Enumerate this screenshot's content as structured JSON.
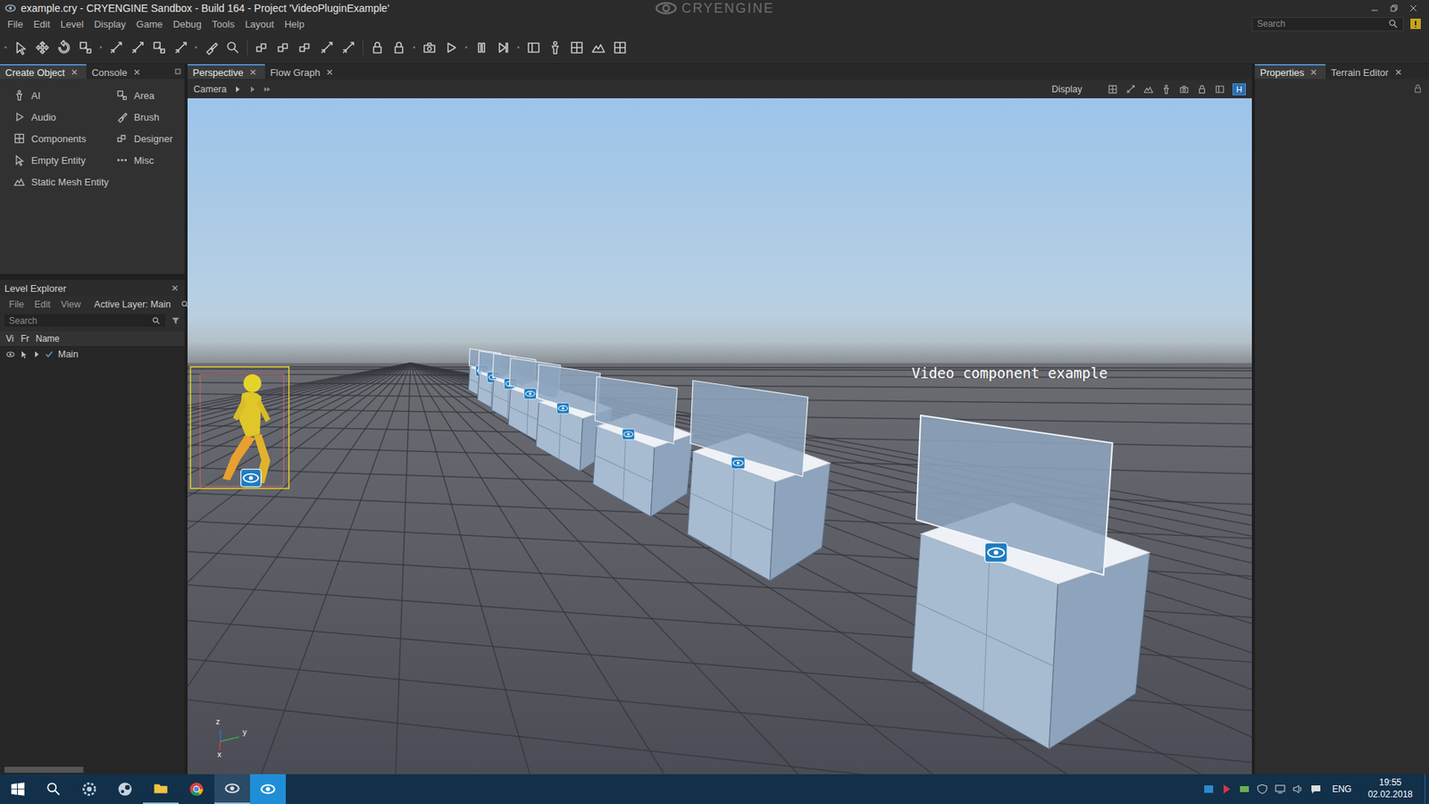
{
  "window": {
    "title": "example.cry - CRYENGINE Sandbox - Build 164 - Project 'VideoPluginExample'",
    "logo": "CRYENGINE"
  },
  "menu": [
    "File",
    "Edit",
    "Level",
    "Display",
    "Game",
    "Debug",
    "Tools",
    "Layout",
    "Help"
  ],
  "global_search": {
    "placeholder": "Search"
  },
  "left_tabs": [
    {
      "label": "Create Object",
      "selected": true
    },
    {
      "label": "Console",
      "selected": false
    }
  ],
  "create_object": [
    "AI",
    "Area",
    "Audio",
    "Brush",
    "Components",
    "Designer",
    "Empty Entity",
    "Misc",
    "Static Mesh Entity"
  ],
  "level_explorer": {
    "title": "Level Explorer",
    "menu": [
      "File",
      "Edit",
      "View"
    ],
    "active_layer": "Active Layer: Main",
    "search": {
      "placeholder": "Search"
    },
    "columns": [
      "Vi",
      "Fr",
      "Name"
    ],
    "rows": [
      {
        "name": "Main",
        "visible": true,
        "checked": true,
        "expanded": false
      }
    ]
  },
  "center_tabs": [
    {
      "label": "Perspective",
      "selected": true
    },
    {
      "label": "Flow Graph",
      "selected": false
    }
  ],
  "viewport": {
    "camera": "Camera",
    "display": "Display",
    "helpers_button": {
      "label": "H",
      "on": true
    },
    "overlay_text": "Video component example",
    "axes": [
      "z",
      "y",
      "x"
    ]
  },
  "right_tabs": [
    {
      "label": "Properties",
      "selected": true
    },
    {
      "label": "Terrain Editor",
      "selected": false
    }
  ],
  "taskbar": {
    "language": "ENG",
    "time": "19:55",
    "date": "02.02.2018"
  }
}
